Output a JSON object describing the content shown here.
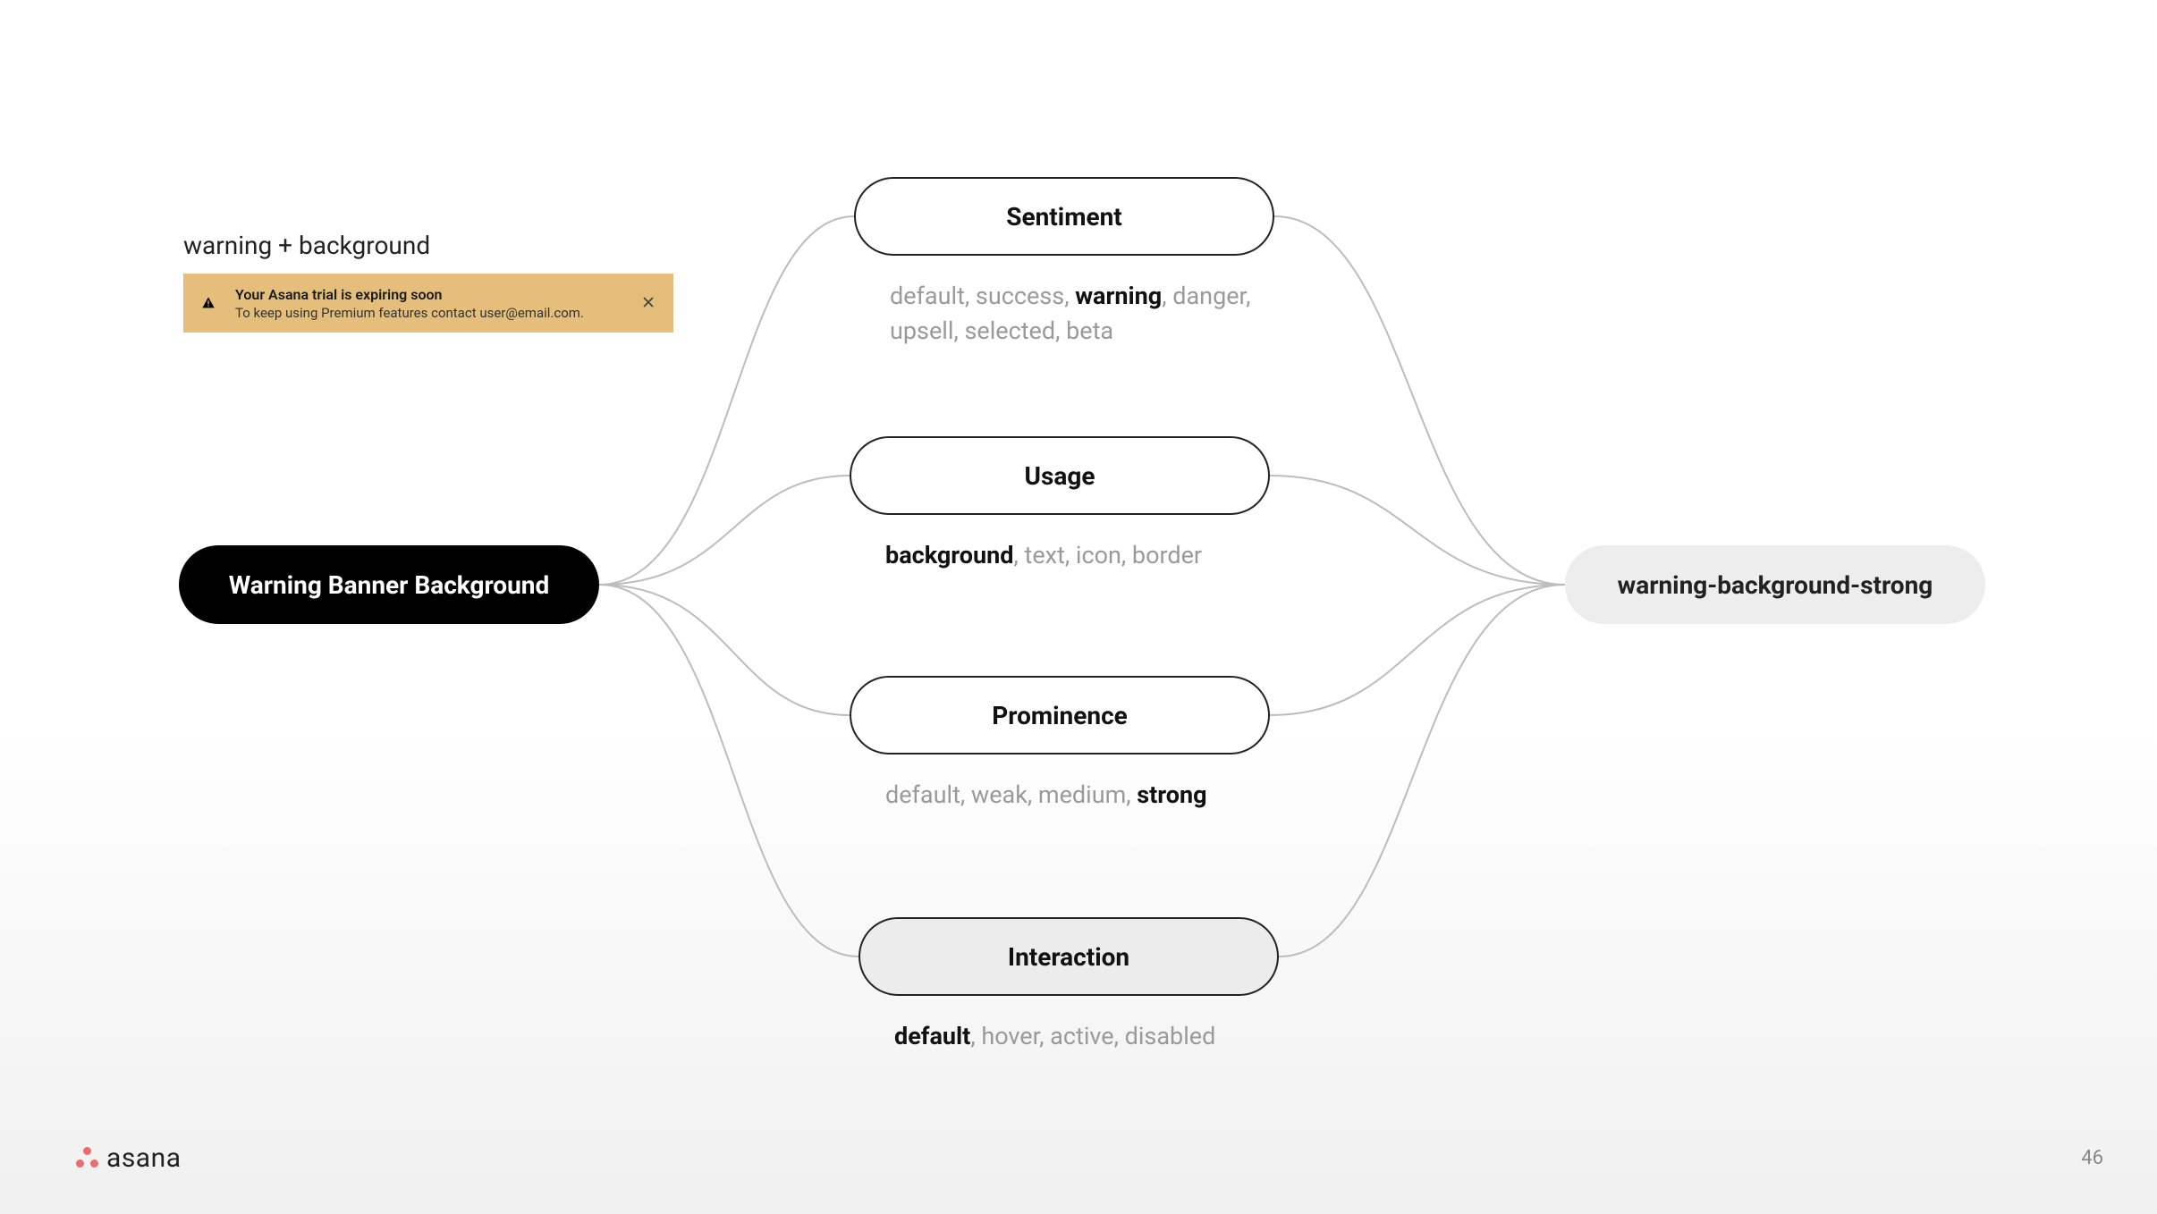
{
  "example": {
    "label": "warning + background",
    "banner_title": "Your Asana trial is expiring soon",
    "banner_subtitle": "To keep using Premium features contact user@email.com."
  },
  "root_pill": "Warning Banner Background",
  "result_pill": "warning-background-strong",
  "categories": [
    {
      "id": "sentiment",
      "title": "Sentiment",
      "values": [
        {
          "text": "default",
          "bold": false
        },
        {
          "text": "success",
          "bold": false
        },
        {
          "text": "warning",
          "bold": true
        },
        {
          "text": "danger",
          "bold": false
        },
        {
          "text": "upsell",
          "bold": false
        },
        {
          "text": "selected",
          "bold": false
        },
        {
          "text": "beta",
          "bold": false
        }
      ]
    },
    {
      "id": "usage",
      "title": "Usage",
      "values": [
        {
          "text": "background",
          "bold": true
        },
        {
          "text": "text",
          "bold": false
        },
        {
          "text": "icon",
          "bold": false
        },
        {
          "text": "border",
          "bold": false
        }
      ]
    },
    {
      "id": "prominence",
      "title": "Prominence",
      "values": [
        {
          "text": "default",
          "bold": false
        },
        {
          "text": "weak",
          "bold": false
        },
        {
          "text": "medium",
          "bold": false
        },
        {
          "text": "strong",
          "bold": true
        }
      ]
    },
    {
      "id": "interaction",
      "title": "Interaction",
      "values": [
        {
          "text": "default",
          "bold": true
        },
        {
          "text": "hover",
          "bold": false
        },
        {
          "text": "active",
          "bold": false
        },
        {
          "text": "disabled",
          "bold": false
        }
      ]
    }
  ],
  "footer": {
    "brand": "asana",
    "page_number": "46"
  }
}
